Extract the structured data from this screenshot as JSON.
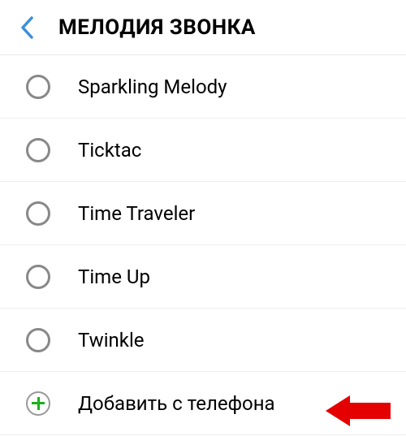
{
  "header": {
    "title": "МЕЛОДИЯ ЗВОНКА"
  },
  "ringtones": [
    {
      "label": "Sparkling Melody"
    },
    {
      "label": "Ticktac"
    },
    {
      "label": "Time Traveler"
    },
    {
      "label": "Time Up"
    },
    {
      "label": "Twinkle"
    }
  ],
  "addFromPhone": {
    "label": "Добавить с телефона"
  },
  "annotation": {
    "arrowColor": "#e40000"
  }
}
